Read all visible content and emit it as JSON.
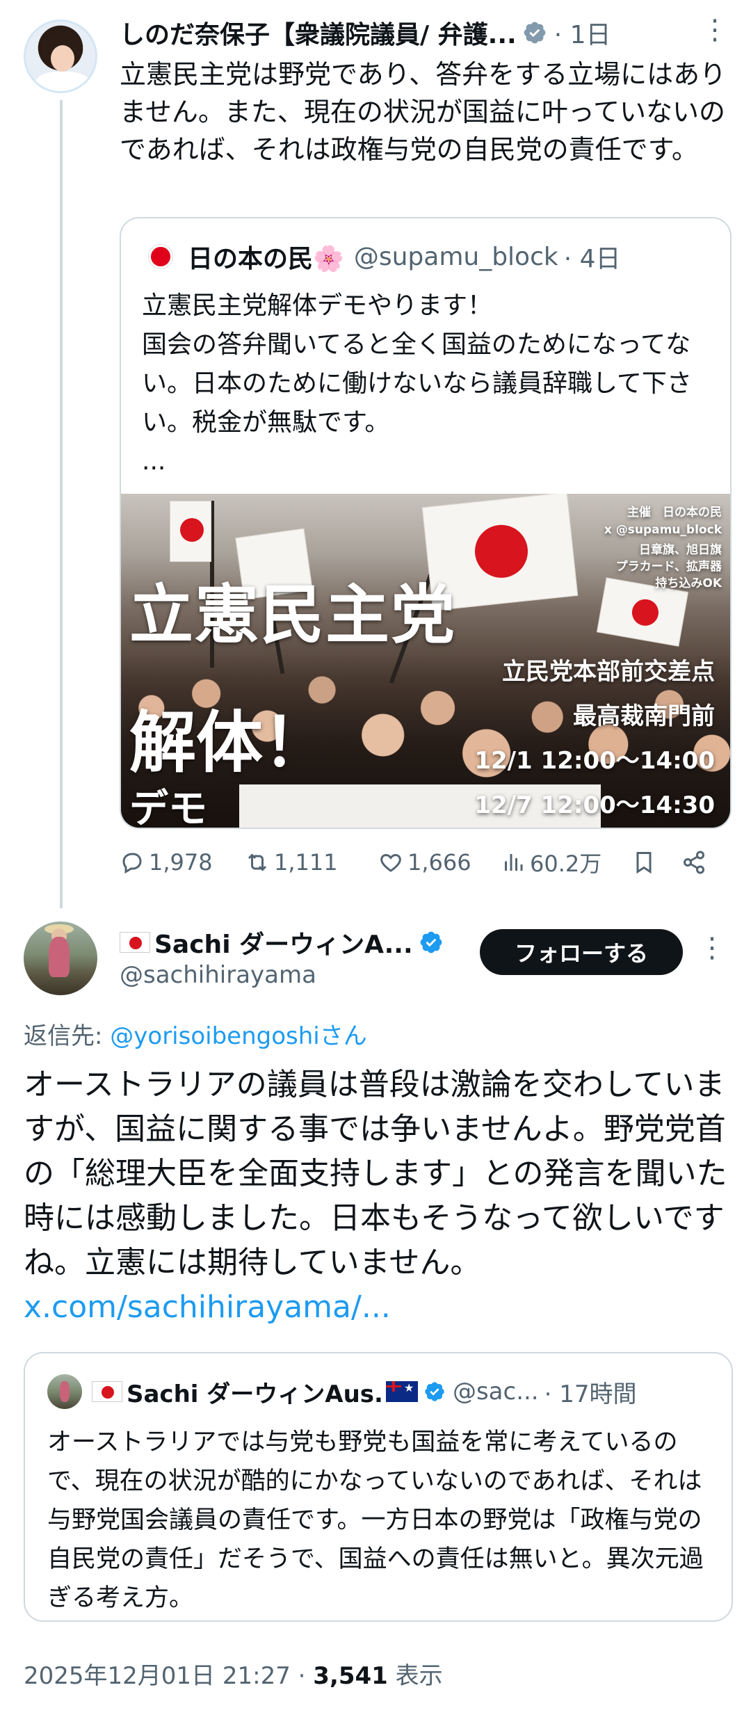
{
  "parent_tweet": {
    "author_name": "しのだ奈保子【衆議院議員/ 弁護...",
    "time": "· 1日",
    "body": "立憲民主党は野党であり、答弁をする立場にはありません。また、現在の状況が国益に叶っていないのであれば、それは政権与党の自民党の責任です。",
    "quote": {
      "author_name": "日の本の民🌸",
      "handle": "@supamu_block",
      "time": "· 4日",
      "body": "立憲民主党解体デモやります！\n国会の答弁聞いてると全く国益のためになってない。日本のために働けないなら議員辞職して下さい。税金が無駄です。\n...",
      "image": {
        "organizer": "主催　日の本の民",
        "x_handle": "x @supamu_block",
        "flags": "日章旗、旭日旗",
        "items": "プラカード、拡声器",
        "bring": "持ち込みOK",
        "headline1": "立憲民主党",
        "headline2": "解体！",
        "headline3": "デモ",
        "place1": "立民党本部前交差点",
        "place2": "最高裁南門前",
        "date1": "12/1 12:00～14:00",
        "date2": "12/7 12:00～14:30"
      }
    },
    "metrics": {
      "replies": "1,978",
      "reposts": "1,111",
      "likes": "1,666",
      "views": "60.2万"
    }
  },
  "reply_tweet": {
    "author_name": "Sachi ダーウィンA...",
    "handle": "@sachihirayama",
    "follow_label": "フォローする",
    "reply_to_prefix": "返信先: ",
    "reply_to_user": "@yorisoibengoshiさん",
    "body": "オーストラリアの議員は普段は激論を交わしていますが、国益に関する事では争いませんよ。野党党首の「総理大臣を全面支持します」との発言を聞いた時には感動しました。日本もそうなって欲しいですね。立憲には期待していません。",
    "body_link": "x.com/sachihirayama/...",
    "quote": {
      "author_name": "Sachi ダーウィンAus.",
      "handle": "@sac...",
      "time": "· 17時間",
      "body": "オーストラリアでは与党も野党も国益を常に考えているので、現在の状況が酷的にかなっていないのであれば、それは与野党国会議員の責任です。一方日本の野党は「政権与党の自民党の責任」だそうで、国益への責任は無いと。異次元過ぎる考え方。"
    },
    "timestamp": "2025年12月01日 21:27 · ",
    "view_count": "3,541",
    "view_label": " 表示"
  },
  "colors": {
    "text": "#0f1419",
    "secondary": "#536471",
    "link": "#1d9bf0",
    "verified": "#1d9bf0",
    "border": "#cfd9de"
  },
  "icons": [
    "verified-badge-icon",
    "more-options-icon",
    "reply-icon",
    "repost-icon",
    "like-icon",
    "views-icon",
    "bookmark-icon",
    "share-icon"
  ]
}
